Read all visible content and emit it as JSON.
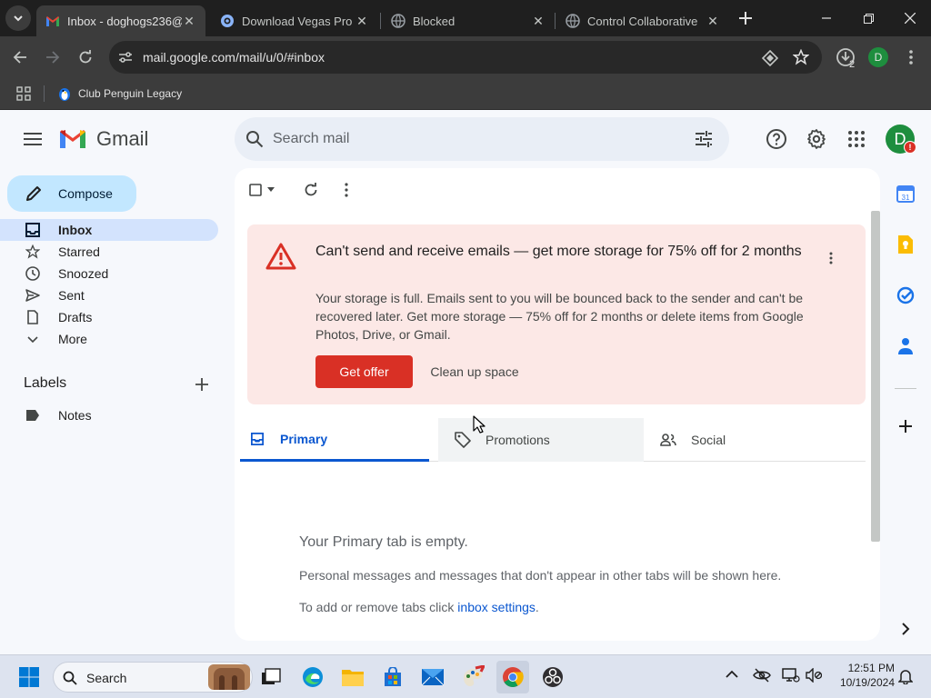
{
  "browser": {
    "tabs": [
      {
        "title": "Inbox - doghogs236@",
        "active": true
      },
      {
        "title": "Download Vegas Pro b"
      },
      {
        "title": "Blocked"
      },
      {
        "title": "Control Collaborative"
      }
    ],
    "url": "mail.google.com/mail/u/0/#inbox",
    "profile_initial": "D",
    "downloads_count": "2",
    "bookmarks": [
      {
        "label": "Club Penguin Legacy"
      }
    ]
  },
  "gmail": {
    "logo_text": "Gmail",
    "search_placeholder": "Search mail",
    "avatar_initial": "D",
    "compose_label": "Compose",
    "nav": [
      {
        "label": "Inbox",
        "icon": "inbox-icon",
        "active": true
      },
      {
        "label": "Starred",
        "icon": "star-icon"
      },
      {
        "label": "Snoozed",
        "icon": "clock-icon"
      },
      {
        "label": "Sent",
        "icon": "send-icon"
      },
      {
        "label": "Drafts",
        "icon": "draft-icon"
      },
      {
        "label": "More",
        "icon": "chevron-down-icon"
      }
    ],
    "labels_heading": "Labels",
    "labels": [
      {
        "label": "Notes"
      }
    ],
    "banner": {
      "title": "Can't send and receive emails — get more storage for 75% off for 2 months",
      "body": "Your storage is full. Emails sent to you will be bounced back to the sender and can't be recovered later. Get more storage — 75% off for 2 months or delete items from Google Photos, Drive, or Gmail.",
      "primary_action": "Get offer",
      "secondary_action": "Clean up space"
    },
    "inbox_tabs": [
      {
        "label": "Primary",
        "active": true
      },
      {
        "label": "Promotions"
      },
      {
        "label": "Social"
      }
    ],
    "empty": {
      "heading": "Your Primary tab is empty.",
      "line1": "Personal messages and messages that don't appear in other tabs will be shown here.",
      "line2_prefix": "To add or remove tabs click ",
      "line2_link": "inbox settings",
      "line2_suffix": "."
    }
  },
  "taskbar": {
    "search_label": "Search",
    "time": "12:51 PM",
    "date": "10/19/2024"
  },
  "colors": {
    "accent_blue": "#0b57d0",
    "gmail_red": "#ea4335",
    "banner_bg": "#fce8e6",
    "button_red": "#d93025",
    "nav_active": "#d3e3fd",
    "avatar_green": "#1e8e3e"
  }
}
